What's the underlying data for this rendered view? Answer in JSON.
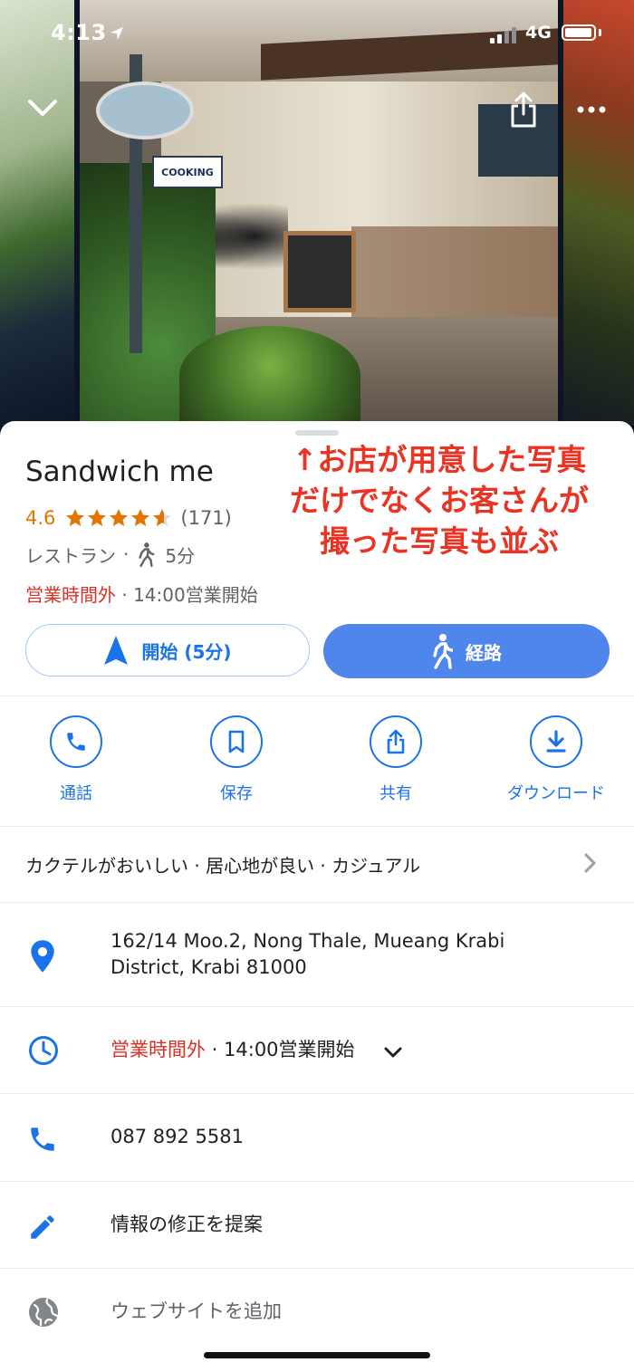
{
  "status_bar": {
    "time": "4:13",
    "network": "4G"
  },
  "gallery": {
    "board_text": "COOKING",
    "icons": {
      "collapse": "chevron-down-icon",
      "share": "share-icon",
      "more": "more-icon"
    }
  },
  "place": {
    "name": "Sandwich me",
    "rating": "4.6",
    "stars": 4.6,
    "review_count": "(171)",
    "category": "レストラン",
    "category_sep": "·",
    "walk_time": "5分",
    "hours_status": "営業時間外",
    "hours_sep": " · ",
    "hours_next": "14:00営業開始"
  },
  "annotation": {
    "line1": "↑お店が用意した写真",
    "line2": "だけでなくお客さんが",
    "line3": "撮った写真も並ぶ"
  },
  "buttons": {
    "start": "開始 (5分)",
    "route": "経路"
  },
  "actions": [
    {
      "label": "通話",
      "icon": "phone-icon"
    },
    {
      "label": "保存",
      "icon": "bookmark-icon"
    },
    {
      "label": "共有",
      "icon": "share-icon"
    },
    {
      "label": "ダウンロード",
      "icon": "download-icon"
    }
  ],
  "tags": "カクテルがおいしい · 居心地が良い · カジュアル",
  "info": {
    "address_line1": "162/14 Moo.2, Nong Thale, Mueang Krabi",
    "address_line2": "District, Krabi 81000",
    "hours_status": "営業時間外",
    "hours_next": " · 14:00営業開始",
    "phone": "087 892 5581",
    "suggest_edit": "情報の修正を提案",
    "add_website": "ウェブサイトを追加"
  },
  "colors": {
    "accent": "#1a73e8",
    "route_button": "#4f86ec",
    "closed_red": "#d93025",
    "rating_orange": "#e37400",
    "annotation_red": "#ea3323"
  }
}
